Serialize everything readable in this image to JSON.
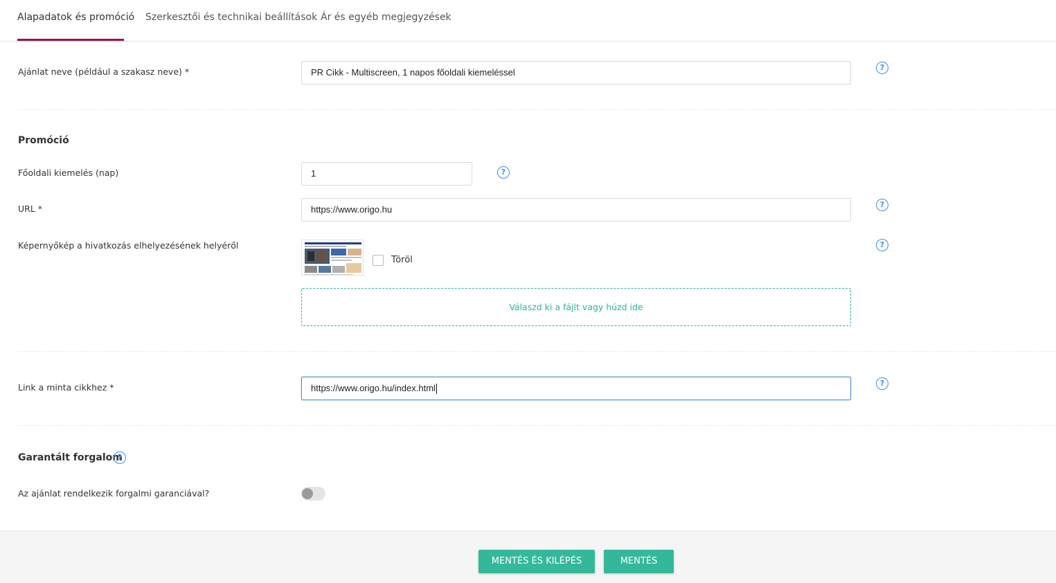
{
  "tabs": [
    {
      "label": "Alapadatok és promóció",
      "active": true
    },
    {
      "label": "Szerkesztői és technikai beállítások",
      "active": false
    },
    {
      "label": "Ár és egyéb megjegyzések",
      "active": false
    }
  ],
  "form": {
    "offer_name": {
      "label": "Ajánlat neve (például a szakasz neve) *",
      "value": "PR Cikk - Multiscreen, 1 napos főoldali kiemeléssel"
    },
    "promotion_title": "Promóció",
    "homepage_highlight": {
      "label": "Főoldali kiemelés (nap)",
      "value": "1"
    },
    "url": {
      "label": "URL *",
      "value": "https://www.origo.hu"
    },
    "screenshot": {
      "label": "Képernyőkép a hivatkozás elhelyezésének helyéről",
      "delete_label": "Töröl",
      "dropzone_text": "Válaszd ki a fájlt vagy húzd ide"
    },
    "sample_link": {
      "label": "Link a minta cikkhez *",
      "value": "https://www.origo.hu/index.html"
    },
    "guaranteed_traffic_title": "Garantált forgalom",
    "traffic_guarantee": {
      "label": "Az ajánlat rendelkezik forgalmi garanciával?",
      "enabled": false
    }
  },
  "help_glyph": "?",
  "footer": {
    "save_and_exit_label": "MENTÉS ÉS KILÉPÉS",
    "save_label": "MENTÉS"
  },
  "colors": {
    "accent_tab": "#a4123f",
    "primary_button": "#33b89a",
    "help_icon": "#3a8ee6"
  }
}
